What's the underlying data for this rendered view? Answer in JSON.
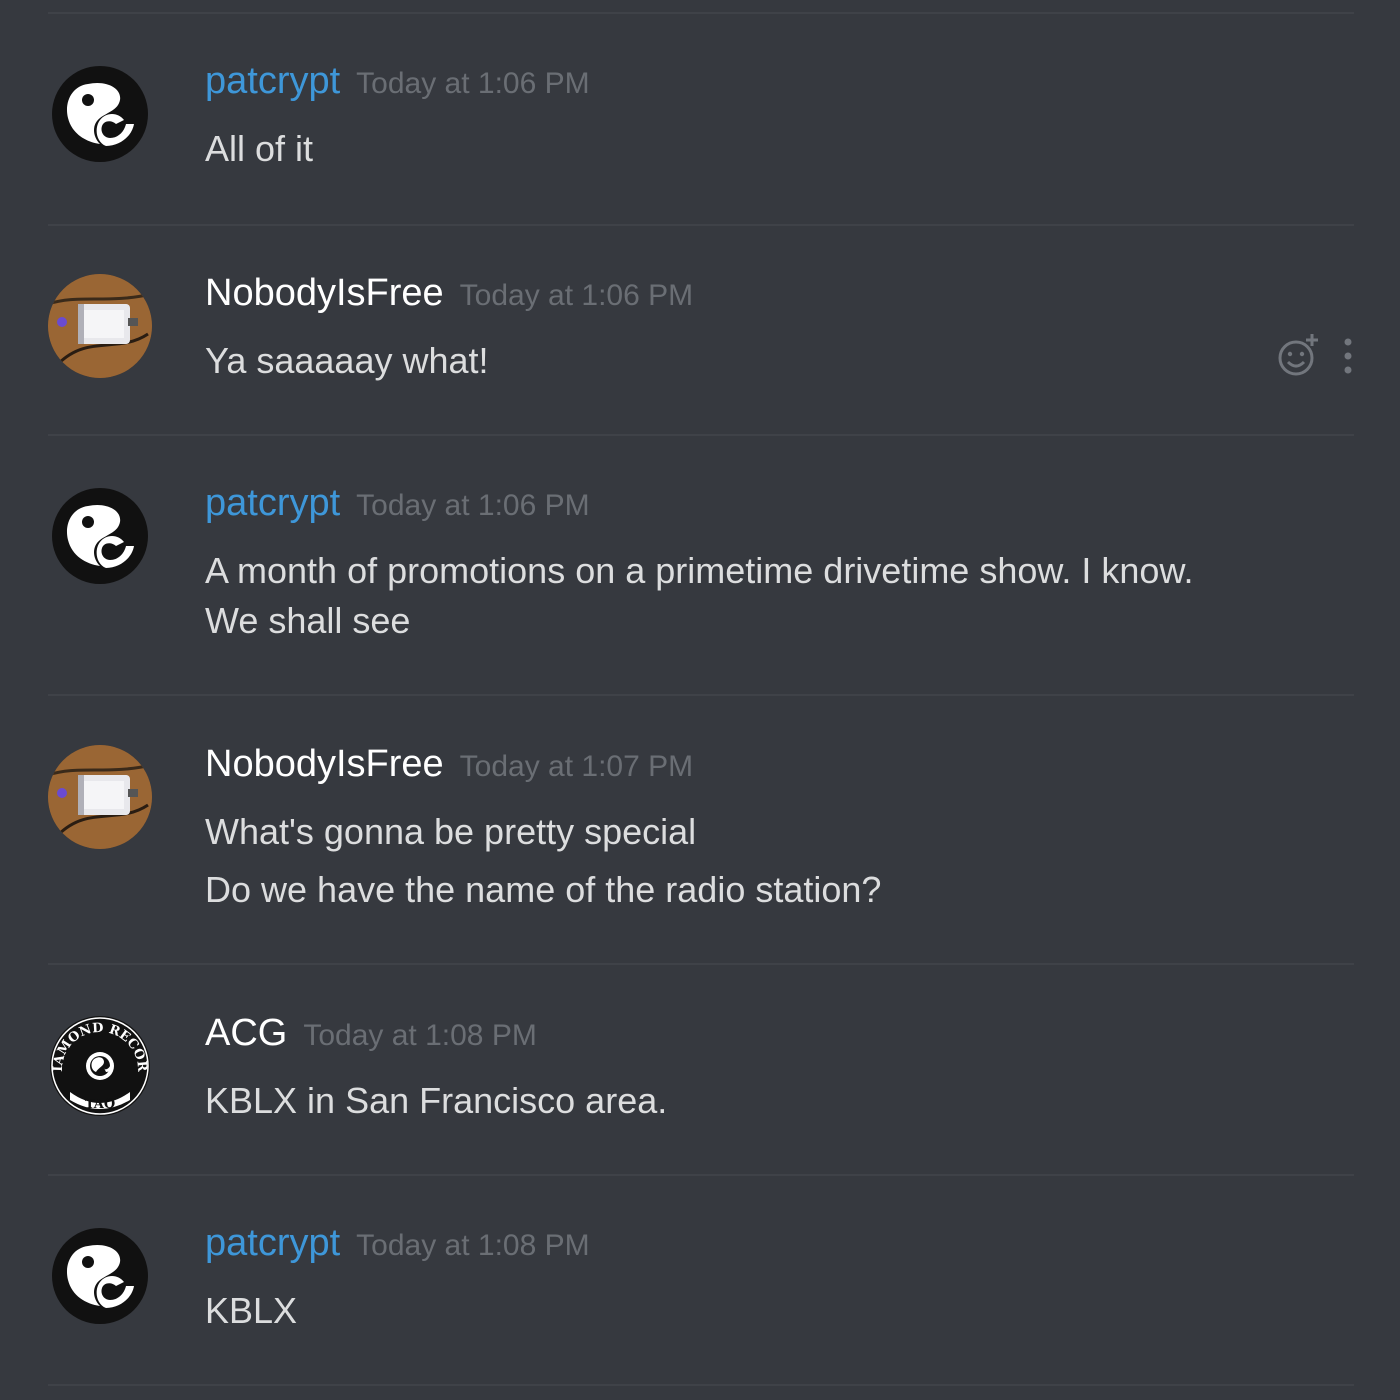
{
  "messages": [
    {
      "username": "patcrypt",
      "timestamp": "Today at 1:06 PM",
      "lines": [
        "All of it"
      ],
      "avatar": "yin-yang-logo-avatar"
    },
    {
      "username": "NobodyIsFree",
      "timestamp": "Today at 1:06 PM",
      "lines": [
        "Ya saaaaay what!"
      ],
      "avatar": "device-photo-avatar"
    },
    {
      "username": "patcrypt",
      "timestamp": "Today at 1:06 PM",
      "lines": [
        "A month of promotions on a primetime drivetime show. I know.",
        "We shall see"
      ],
      "avatar": "yin-yang-logo-avatar"
    },
    {
      "username": "NobodyIsFree",
      "timestamp": "Today at 1:07 PM",
      "lines": [
        "What's gonna be pretty special",
        "Do we have the name of the radio station?"
      ],
      "avatar": "device-photo-avatar"
    },
    {
      "username": "ACG",
      "timestamp": "Today at 1:08 PM",
      "lines": [
        "KBLX in San Francisco area."
      ],
      "avatar": "diamond-record-avatar",
      "avatar_text": {
        "top": "DIAMOND RECORD",
        "bottom": "TAO"
      }
    },
    {
      "username": "patcrypt",
      "timestamp": "Today at 1:08 PM",
      "lines": [
        "KBLX"
      ],
      "avatar": "yin-yang-logo-avatar"
    }
  ],
  "hover_actions": {
    "icons": [
      "add-reaction-icon",
      "more-options-icon"
    ]
  },
  "colors": {
    "background": "#36393f",
    "username_patcrypt": "#3e97d9",
    "username_default": "#ffffff",
    "timestamp": "#6a6e74",
    "message_text": "#dcddde",
    "divider": "#3f4248"
  }
}
